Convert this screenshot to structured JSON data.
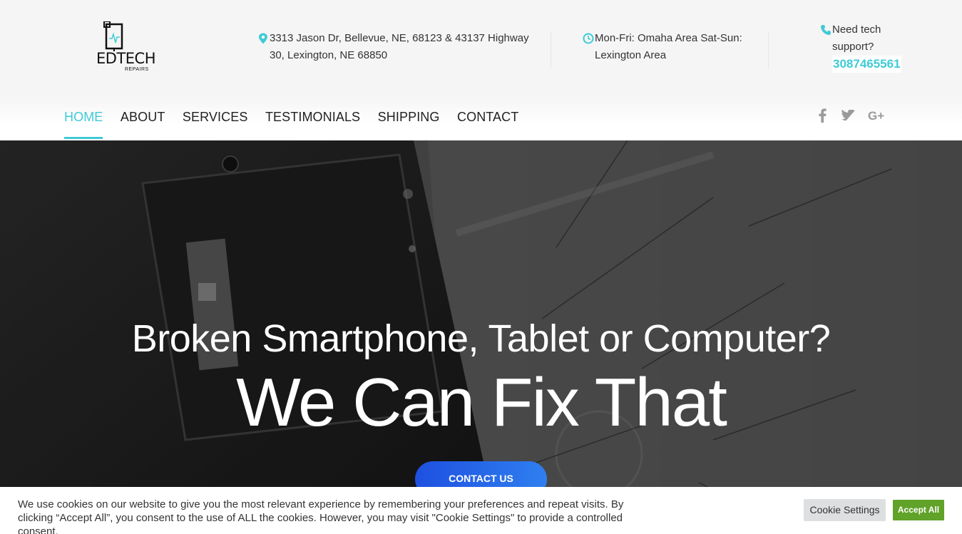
{
  "brand": {
    "logo_text": "EDTECH",
    "logo_sub": "REPAIRS",
    "accent_color": "#3ecbd6"
  },
  "header": {
    "address": {
      "icon": "map-marker-icon",
      "text": "3313 Jason Dr, Bellevue, NE, 68123 & 43137 Highway 30, Lexington, NE 68850"
    },
    "hours": {
      "icon": "clock-icon",
      "text": "Mon-Fri: Omaha Area Sat-Sun: Lexington Area"
    },
    "support": {
      "icon": "phone-icon",
      "text": "Need tech support?",
      "phone": "3087465561"
    }
  },
  "nav": {
    "items": [
      {
        "label": "HOME",
        "active": true
      },
      {
        "label": "ABOUT"
      },
      {
        "label": "SERVICES"
      },
      {
        "label": "TESTIMONIALS"
      },
      {
        "label": "SHIPPING"
      },
      {
        "label": "CONTACT"
      }
    ],
    "social": [
      {
        "icon": "facebook-icon",
        "glyph": "f"
      },
      {
        "icon": "twitter-icon",
        "glyph": ""
      },
      {
        "icon": "google-plus-icon",
        "glyph": "G+"
      }
    ]
  },
  "hero": {
    "subtitle": "Broken Smartphone, Tablet or Computer?",
    "title": "We Can Fix That",
    "cta_label": "CONTACT US"
  },
  "cookie": {
    "text": "We use cookies on our website to give you the most relevant experience by remembering your preferences and repeat visits. By clicking “Accept All”, you consent to the use of ALL the cookies. However, you may visit \"Cookie Settings\" to provide a controlled consent.",
    "settings_label": "Cookie Settings",
    "accept_label": "Accept All"
  }
}
